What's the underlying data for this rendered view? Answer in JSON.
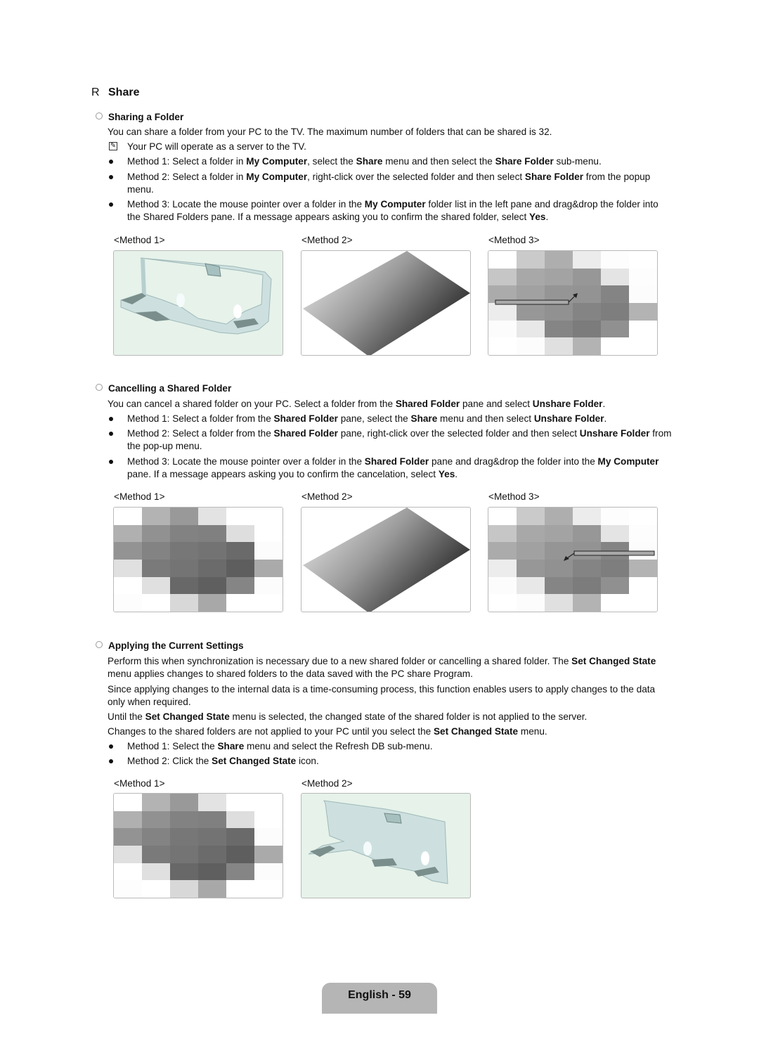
{
  "section": {
    "marker": "R",
    "title": "Share"
  },
  "sharing": {
    "heading": "Sharing a Folder",
    "intro": "You can share a folder from your PC to the TV. The maximum number of folders that can be shared is 32.",
    "note": "Your PC will operate as a server to the TV.",
    "note_icon": "note-pencil-icon",
    "bullets": [
      [
        {
          "t": "Method 1: Select a folder in "
        },
        {
          "t": "My Computer",
          "b": true
        },
        {
          "t": ", select the "
        },
        {
          "t": "Share",
          "b": true
        },
        {
          "t": " menu and then select the "
        },
        {
          "t": "Share Folder",
          "b": true
        },
        {
          "t": " sub-menu."
        }
      ],
      [
        {
          "t": "Method 2: Select a folder in "
        },
        {
          "t": "My Computer",
          "b": true
        },
        {
          "t": ", right-click over the selected folder and then select "
        },
        {
          "t": "Share Folder",
          "b": true
        },
        {
          "t": " from the popup menu."
        }
      ],
      [
        {
          "t": "Method 3: Locate the mouse pointer over a folder in the "
        },
        {
          "t": "My Computer",
          "b": true
        },
        {
          "t": " folder list in the left pane and drag&drop the folder into the Shared Folders pane. If a message appears asking you to confirm the shared folder, select "
        },
        {
          "t": "Yes",
          "b": true
        },
        {
          "t": "."
        }
      ]
    ],
    "figures": [
      "<Method 1>",
      "<Method 2>",
      "<Method 3>"
    ]
  },
  "cancelling": {
    "heading": "Cancelling a Shared Folder",
    "intro": [
      {
        "t": "You can cancel a shared folder on your PC. Select a folder from the "
      },
      {
        "t": "Shared Folder",
        "b": true
      },
      {
        "t": " pane and select "
      },
      {
        "t": "Unshare Folder",
        "b": true
      },
      {
        "t": "."
      }
    ],
    "bullets": [
      [
        {
          "t": "Method 1: Select a folder from the "
        },
        {
          "t": "Shared Folder",
          "b": true
        },
        {
          "t": " pane, select the "
        },
        {
          "t": "Share",
          "b": true
        },
        {
          "t": " menu and then select "
        },
        {
          "t": "Unshare Folder",
          "b": true
        },
        {
          "t": "."
        }
      ],
      [
        {
          "t": "Method 2: Select a folder from the "
        },
        {
          "t": "Shared Folder",
          "b": true
        },
        {
          "t": " pane, right-click over the selected folder and then select "
        },
        {
          "t": "Unshare Folder",
          "b": true
        },
        {
          "t": " from the pop-up menu."
        }
      ],
      [
        {
          "t": "Method 3: Locate the mouse pointer over a folder in the "
        },
        {
          "t": "Shared Folder",
          "b": true
        },
        {
          "t": " pane and drag&drop the folder into the "
        },
        {
          "t": "My Computer",
          "b": true
        },
        {
          "t": " pane. If a message appears asking you to confirm the cancelation, select "
        },
        {
          "t": "Yes",
          "b": true
        },
        {
          "t": "."
        }
      ]
    ],
    "figures": [
      "<Method 1>",
      "<Method 2>",
      "<Method 3>"
    ]
  },
  "applying": {
    "heading": "Applying the Current Settings",
    "paragraphs": [
      [
        {
          "t": "Perform this when synchronization is necessary due to a new shared folder or cancelling a shared folder. The "
        },
        {
          "t": "Set Changed State",
          "b": true
        },
        {
          "t": " menu applies changes to shared folders to the data saved with the PC share Program."
        }
      ],
      [
        {
          "t": "Since applying changes to the internal data is a time-consuming process, this function enables users to apply changes to the data only when required."
        }
      ],
      [
        {
          "t": "Until the "
        },
        {
          "t": "Set Changed State",
          "b": true
        },
        {
          "t": " menu is selected, the changed state of the shared folder is not applied to the server."
        }
      ],
      [
        {
          "t": "Changes to the shared folders are not applied to your PC until you select the "
        },
        {
          "t": "Set Changed State",
          "b": true
        },
        {
          "t": " menu."
        }
      ]
    ],
    "bullets": [
      [
        {
          "t": "Method 1: Select the "
        },
        {
          "t": "Share",
          "b": true
        },
        {
          "t": " menu and select the Refresh DB sub-menu."
        }
      ],
      [
        {
          "t": "Method 2: Click the "
        },
        {
          "t": "Set Changed State",
          "b": true
        },
        {
          "t": " icon."
        }
      ]
    ],
    "figures": [
      "<Method 1>",
      "<Method 2>"
    ]
  },
  "mosaic_a": [
    [
      "#ffffff",
      "#b3b3b3",
      "#999999",
      "#e3e3e3",
      "#ffffff",
      "#ffffff"
    ],
    [
      "#b0b0b0",
      "#919191",
      "#828282",
      "#808080",
      "#dedede",
      "#ffffff"
    ],
    [
      "#939393",
      "#838383",
      "#777777",
      "#737373",
      "#6a6a6a",
      "#fcfcfc"
    ],
    [
      "#e0e0e0",
      "#7a7a7a",
      "#747474",
      "#6b6b6b",
      "#5e5e5e",
      "#aaaaaa"
    ],
    [
      "#ffffff",
      "#e0e0e0",
      "#686868",
      "#5f5f5f",
      "#858585",
      "#fcfcfc"
    ],
    [
      "#fdfdfd",
      "#ffffff",
      "#d8d8d8",
      "#a8a8a8",
      "#ffffff",
      "#ffffff"
    ]
  ],
  "mosaic_b": [
    [
      "#ffffff",
      "#cacaca",
      "#aeaeae",
      "#ececec",
      "#fdfdfd",
      "#ffffff"
    ],
    [
      "#c6c6c6",
      "#a8a8a8",
      "#a3a3a3",
      "#979797",
      "#e4e4e4",
      "#fdfdfd"
    ],
    [
      "#ababab",
      "#a1a1a1",
      "#959595",
      "#939393",
      "#848484",
      "#fcfcfc"
    ],
    [
      "#ececec",
      "#979797",
      "#919191",
      "#848484",
      "#7e7e7e",
      "#b3b3b3"
    ],
    [
      "#fcfcfc",
      "#e8e8e8",
      "#858585",
      "#7c7c7c",
      "#909090",
      "#ffffff"
    ],
    [
      "#ffffff",
      "#fcfcfc",
      "#e0e0e0",
      "#b3b3b3",
      "#ffffff",
      "#ffffff"
    ]
  ],
  "footer": {
    "label": "English - 59",
    "color": "#b5b5b5"
  }
}
